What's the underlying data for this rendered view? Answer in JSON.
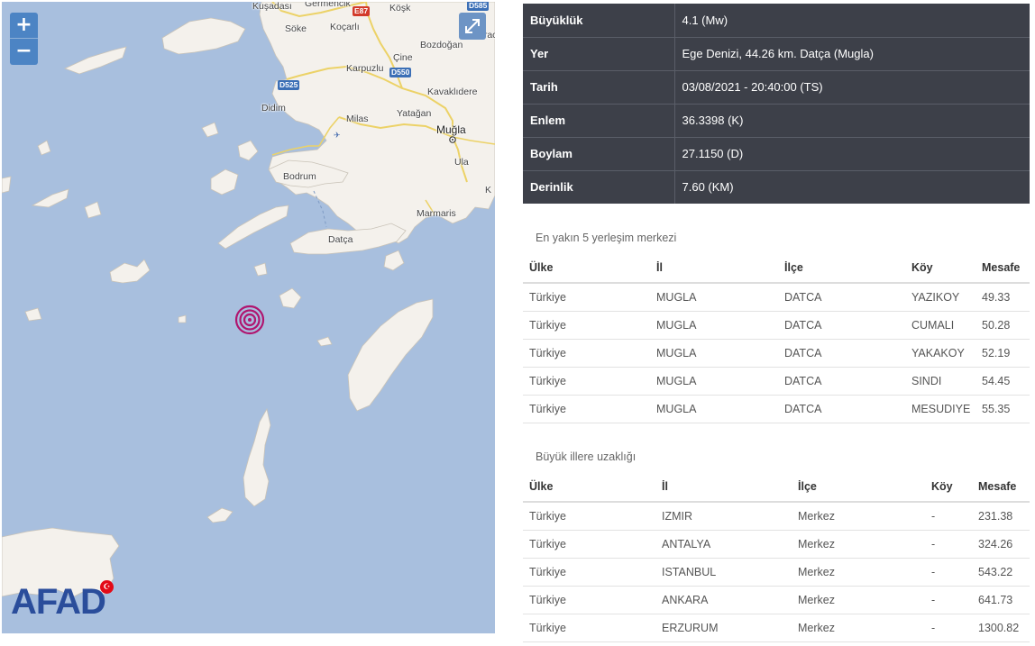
{
  "map": {
    "zoom_in": "+",
    "zoom_out": "−",
    "logo_text": "AFAD",
    "flag_glyph": "☪",
    "places": [
      {
        "id": "kusadasi",
        "name": "Kuşadası"
      },
      {
        "id": "germencik",
        "name": "Germencik"
      },
      {
        "id": "kosk",
        "name": "Köşk"
      },
      {
        "id": "soke",
        "name": "Söke"
      },
      {
        "id": "kocarli",
        "name": "Koçarlı"
      },
      {
        "id": "bozdogan",
        "name": "Bozdoğan"
      },
      {
        "id": "karacasu",
        "name": "Karac"
      },
      {
        "id": "cine",
        "name": "Çine"
      },
      {
        "id": "karpuzlu",
        "name": "Karpuzlu"
      },
      {
        "id": "kavaklidere",
        "name": "Kavaklıdere"
      },
      {
        "id": "didim",
        "name": "Didim"
      },
      {
        "id": "milas",
        "name": "Milas"
      },
      {
        "id": "yatagan",
        "name": "Yatağan"
      },
      {
        "id": "mugla",
        "name": "Muğla"
      },
      {
        "id": "ula",
        "name": "Ula"
      },
      {
        "id": "bodrum",
        "name": "Bodrum"
      },
      {
        "id": "kcut",
        "name": "K"
      },
      {
        "id": "marmaris",
        "name": "Marmaris"
      },
      {
        "id": "datca",
        "name": "Datça"
      }
    ],
    "roads": [
      {
        "id": "e87",
        "label": "E87"
      },
      {
        "id": "d585",
        "label": "D585"
      },
      {
        "id": "d550",
        "label": "D550"
      },
      {
        "id": "d525",
        "label": "D525"
      }
    ]
  },
  "details": [
    {
      "key": "Büyüklük",
      "value": "4.1 (Mw)"
    },
    {
      "key": "Yer",
      "value": "Ege Denizi, 44.26 km. Datça (Mugla)"
    },
    {
      "key": "Tarih",
      "value": "03/08/2021 - 20:40:00 (TS)"
    },
    {
      "key": "Enlem",
      "value": "36.3398 (K)"
    },
    {
      "key": "Boylam",
      "value": "27.1150 (D)"
    },
    {
      "key": "Derinlik",
      "value": "7.60 (KM)"
    }
  ],
  "nearest": {
    "caption": "En yakın 5 yerleşim merkezi",
    "headers": [
      "Ülke",
      "İl",
      "İlçe",
      "Köy",
      "Mesafe"
    ],
    "rows": [
      [
        "Türkiye",
        "MUGLA",
        "DATCA",
        "YAZIKOY",
        "49.33"
      ],
      [
        "Türkiye",
        "MUGLA",
        "DATCA",
        "CUMALI",
        "50.28"
      ],
      [
        "Türkiye",
        "MUGLA",
        "DATCA",
        "YAKAKOY",
        "52.19"
      ],
      [
        "Türkiye",
        "MUGLA",
        "DATCA",
        "SINDI",
        "54.45"
      ],
      [
        "Türkiye",
        "MUGLA",
        "DATCA",
        "MESUDIYE",
        "55.35"
      ]
    ]
  },
  "cities": {
    "caption": "Büyük illere uzaklığı",
    "headers": [
      "Ülke",
      "İl",
      "İlçe",
      "Köy",
      "Mesafe"
    ],
    "rows": [
      [
        "Türkiye",
        "IZMIR",
        "Merkez",
        "-",
        "231.38"
      ],
      [
        "Türkiye",
        "ANTALYA",
        "Merkez",
        "-",
        "324.26"
      ],
      [
        "Türkiye",
        "ISTANBUL",
        "Merkez",
        "-",
        "543.22"
      ],
      [
        "Türkiye",
        "ANKARA",
        "Merkez",
        "-",
        "641.73"
      ],
      [
        "Türkiye",
        "ERZURUM",
        "Merkez",
        "-",
        "1300.82"
      ]
    ]
  }
}
